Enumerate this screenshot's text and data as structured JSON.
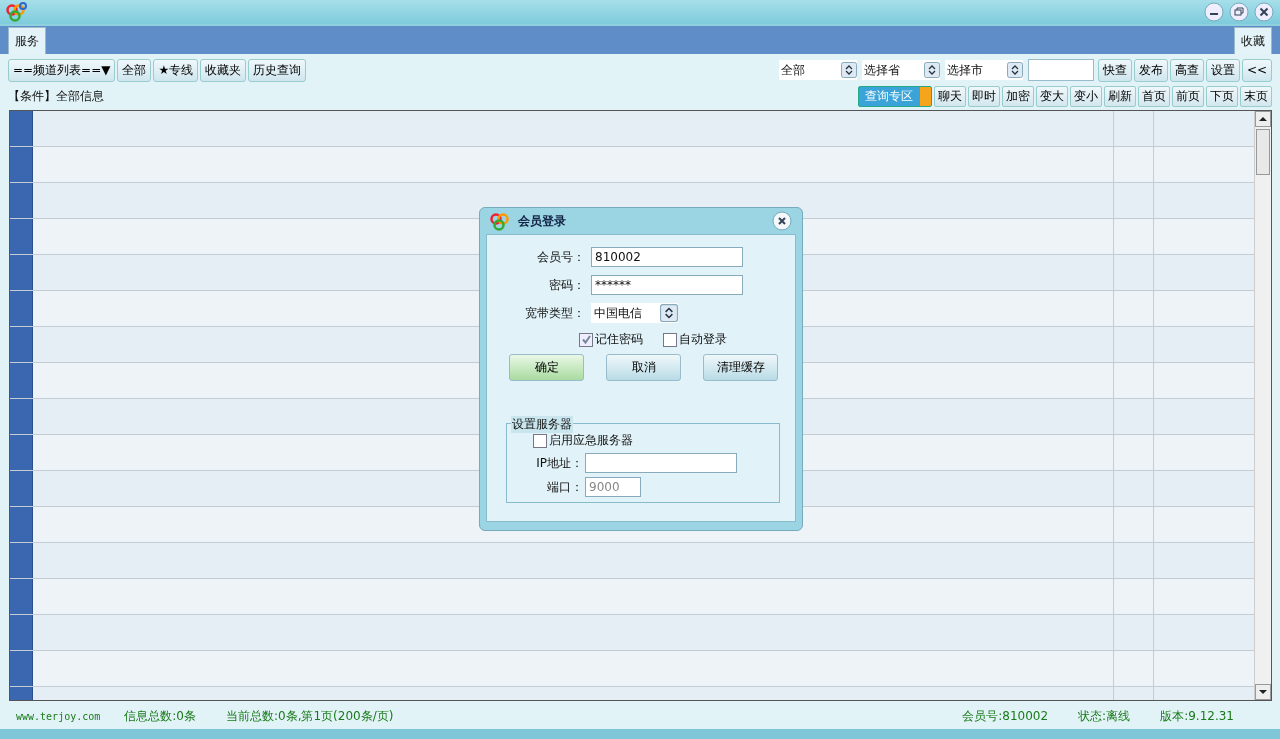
{
  "tabs": [
    {
      "label": "服务",
      "selected": true
    }
  ],
  "right_tab": {
    "label": "收藏"
  },
  "left_buttons": [
    "==频道列表==▼",
    "全部",
    "★专线",
    "收藏夹",
    "历史查询"
  ],
  "filters": [
    {
      "kind": "select",
      "value": "全部"
    },
    {
      "kind": "select",
      "value": "选择省"
    },
    {
      "kind": "select",
      "value": "选择市"
    }
  ],
  "right_buttons": [
    "快查",
    "发布",
    "高查",
    "设置",
    "<<"
  ],
  "condition": "【条件】全部信息",
  "view_buttons": [
    {
      "label": "查询专区",
      "kind": "primary"
    },
    {
      "label": "聊天",
      "kind": "plain"
    },
    {
      "label": "即时",
      "kind": "plain"
    },
    {
      "label": "加密",
      "kind": "plain"
    },
    {
      "label": "变大",
      "kind": "plain"
    },
    {
      "label": "变小",
      "kind": "plain"
    },
    {
      "label": "刷新",
      "kind": "plain"
    },
    {
      "label": "首页",
      "kind": "plain"
    },
    {
      "label": "前页",
      "kind": "plain"
    },
    {
      "label": "下页",
      "kind": "plain"
    },
    {
      "label": "末页",
      "kind": "plain"
    }
  ],
  "dialog": {
    "title": "会员登录",
    "fields": [
      {
        "label": "会员号：",
        "value": "810002",
        "kind": "text"
      },
      {
        "label": "密码：",
        "value": "******",
        "kind": "text"
      },
      {
        "label": "宽带类型：",
        "value": "中国电信",
        "kind": "select"
      }
    ],
    "checkboxes": [
      {
        "label": "记住密码",
        "checked": true
      },
      {
        "label": "自动登录",
        "checked": false
      }
    ],
    "buttons": [
      {
        "label": "确定",
        "kind": "primary"
      },
      {
        "label": "取消",
        "kind": "plain"
      },
      {
        "label": "清理缓存",
        "kind": "plain"
      }
    ],
    "server": {
      "legend": "设置服务器",
      "enable": {
        "label": "启用应急服务器",
        "checked": false
      },
      "ip": {
        "label": "IP地址："
      },
      "port": {
        "label": "端口：",
        "value": "9000",
        "disabled": true
      }
    }
  },
  "status_bar": {
    "website": "www.terjoy.com",
    "left": [
      "信息总数:0条",
      "当前总数:0条,第1页(200条/页)"
    ],
    "right": [
      "会员号:810002",
      "状态:离线",
      "版本:9.12.31"
    ]
  }
}
